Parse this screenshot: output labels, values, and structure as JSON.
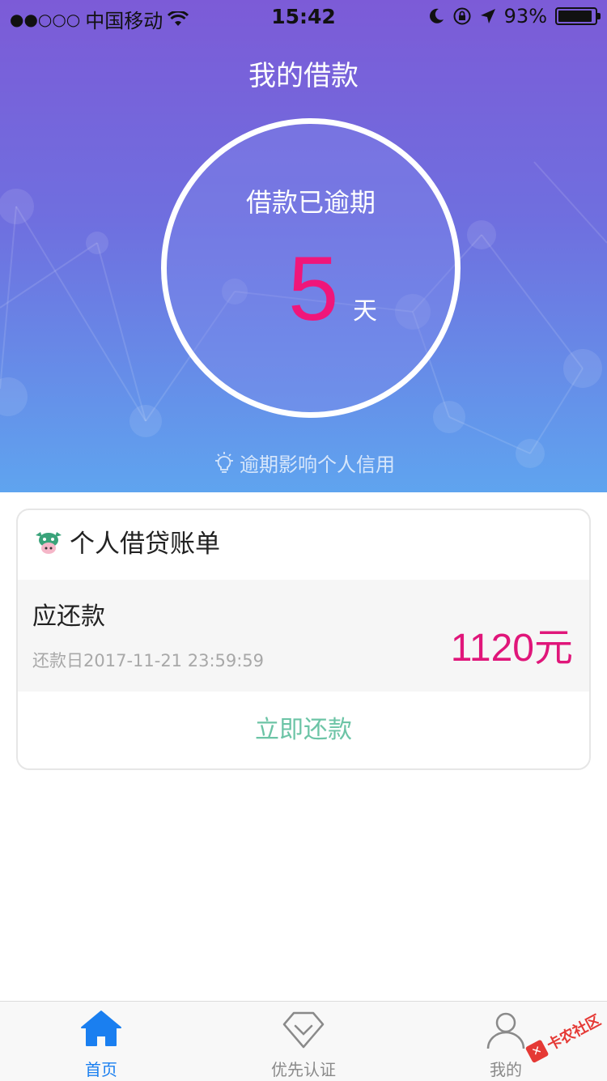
{
  "status_bar": {
    "signal_dots": "●●○○○",
    "carrier": "中国移动",
    "time": "15:42",
    "battery_text": "93%",
    "battery_level": 0.93
  },
  "header": {
    "title": "我的借款"
  },
  "overdue": {
    "label": "借款已逾期",
    "days": "5",
    "unit": "天",
    "tip": "逾期影响个人信用"
  },
  "bill": {
    "title": "个人借贷账单",
    "due_label": "应还款",
    "due_date": "还款日2017-11-21 23:59:59",
    "amount": "1120元",
    "pay_button": "立即还款"
  },
  "tabbar": {
    "items": [
      {
        "label": "首页",
        "icon": "home-icon",
        "active": true
      },
      {
        "label": "优先认证",
        "icon": "certify-icon",
        "active": false
      },
      {
        "label": "我的",
        "icon": "profile-icon",
        "active": false
      }
    ]
  },
  "watermark": {
    "text": "卡农社区"
  },
  "colors": {
    "accent_pink": "#f0167a",
    "accent_blue": "#1a7ff0",
    "action_green": "#6cc4a6",
    "header_top": "#7c5bd7",
    "header_bottom": "#5fa4ef"
  }
}
